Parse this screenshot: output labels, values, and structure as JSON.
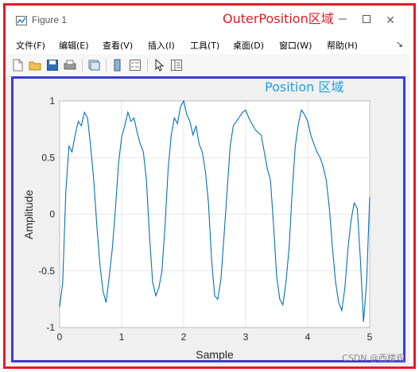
{
  "window": {
    "title": "Figure 1",
    "minimize_icon": "minimize-icon",
    "maximize_icon": "maximize-icon",
    "close_icon": "close-icon",
    "maximize_glyph": "☐",
    "close_glyph": "✕"
  },
  "menu": {
    "items": [
      "文件(F)",
      "编辑(E)",
      "查看(V)",
      "插入(I)",
      "工具(T)",
      "桌面(D)",
      "窗口(W)",
      "帮助(H)"
    ],
    "overflow_glyph": "↘"
  },
  "toolbar": {
    "icons": [
      "new-file-icon",
      "open-folder-icon",
      "save-icon",
      "print-icon",
      "link-plot-icon",
      "colorbar-icon",
      "legend-icon",
      "pointer-icon",
      "property-inspector-icon"
    ]
  },
  "annotations": {
    "outer_label": "OuterPosition区域",
    "inner_label": "Position 区域",
    "outer_color": "#e31b23",
    "inner_color": "#3b3bd6",
    "inner_label_color": "#1aa0e6"
  },
  "watermark": "CSDN @西楼观",
  "chart_data": {
    "type": "line",
    "title": "",
    "xlabel": "Sample",
    "ylabel": "Amplitude",
    "xlim": [
      0,
      5
    ],
    "ylim": [
      -1,
      1
    ],
    "xticks": [
      0,
      1,
      2,
      3,
      4,
      5
    ],
    "yticks": [
      -1,
      -0.5,
      0,
      0.5,
      1
    ],
    "grid": true,
    "line_color": "#0072bd",
    "series": [
      {
        "x": [
          0,
          0.05,
          0.1,
          0.15,
          0.2,
          0.25,
          0.3,
          0.35,
          0.4,
          0.45,
          0.5,
          0.55,
          0.6,
          0.65,
          0.7,
          0.75,
          0.8,
          0.85,
          0.9,
          0.95,
          1.0,
          1.05,
          1.1,
          1.15,
          1.2,
          1.25,
          1.3,
          1.35,
          1.4,
          1.45,
          1.5,
          1.55,
          1.6,
          1.65,
          1.7,
          1.75,
          1.8,
          1.85,
          1.9,
          1.95,
          2.0,
          2.05,
          2.1,
          2.15,
          2.2,
          2.25,
          2.3,
          2.35,
          2.4,
          2.45,
          2.5,
          2.55,
          2.6,
          2.65,
          2.7,
          2.75,
          2.8,
          2.85,
          2.9,
          2.95,
          3.0,
          3.05,
          3.1,
          3.15,
          3.2,
          3.25,
          3.3,
          3.35,
          3.4,
          3.45,
          3.5,
          3.55,
          3.6,
          3.65,
          3.7,
          3.75,
          3.8,
          3.85,
          3.9,
          3.95,
          4.0,
          4.05,
          4.1,
          4.15,
          4.2,
          4.25,
          4.3,
          4.35,
          4.4,
          4.45,
          4.5,
          4.55,
          4.6,
          4.65,
          4.7,
          4.75,
          4.8,
          4.85,
          4.9,
          4.95,
          5.0
        ],
        "y": [
          -0.82,
          -0.6,
          0.2,
          0.6,
          0.55,
          0.7,
          0.82,
          0.78,
          0.9,
          0.85,
          0.6,
          0.3,
          -0.1,
          -0.45,
          -0.68,
          -0.78,
          -0.55,
          -0.3,
          0.05,
          0.45,
          0.68,
          0.78,
          0.9,
          0.82,
          0.85,
          0.72,
          0.62,
          0.55,
          0.3,
          -0.2,
          -0.6,
          -0.72,
          -0.65,
          -0.5,
          -0.1,
          0.4,
          0.7,
          0.85,
          0.8,
          0.95,
          1.0,
          0.88,
          0.82,
          0.7,
          0.78,
          0.62,
          0.55,
          0.38,
          0.1,
          -0.4,
          -0.72,
          -0.75,
          -0.58,
          -0.2,
          0.2,
          0.6,
          0.78,
          0.82,
          0.86,
          0.9,
          0.92,
          0.85,
          0.8,
          0.75,
          0.72,
          0.7,
          0.55,
          0.4,
          0.3,
          -0.1,
          -0.55,
          -0.75,
          -0.8,
          -0.6,
          -0.3,
          0.2,
          0.6,
          0.8,
          0.92,
          0.88,
          0.82,
          0.7,
          0.62,
          0.55,
          0.5,
          0.42,
          0.3,
          0.05,
          -0.3,
          -0.6,
          -0.78,
          -0.85,
          -0.65,
          -0.3,
          -0.05,
          0.1,
          0.05,
          -0.4,
          -0.95,
          -0.6,
          0.15
        ]
      }
    ]
  }
}
